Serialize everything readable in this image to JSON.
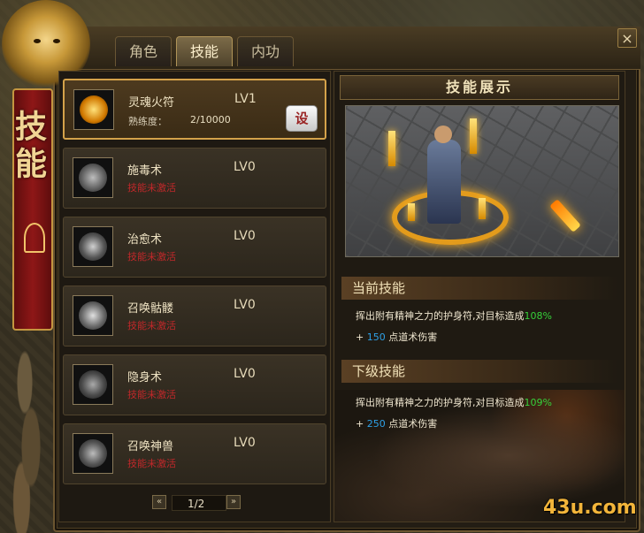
{
  "window": {
    "side_title": "技能",
    "close_label": "×"
  },
  "tabs": [
    {
      "label": "角色",
      "active": false
    },
    {
      "label": "技能",
      "active": true
    },
    {
      "label": "内功",
      "active": false
    }
  ],
  "skills": [
    {
      "name": "灵魂火符",
      "level": "LV1",
      "proficiency_label": "熟练度：",
      "proficiency_value": "2/10000",
      "set_label": "设",
      "selected": true,
      "icon": "soul-fire-talisman-icon"
    },
    {
      "name": "施毒术",
      "level": "LV0",
      "status": "技能未激活",
      "icon": "poison-icon"
    },
    {
      "name": "治愈术",
      "level": "LV0",
      "status": "技能未激活",
      "icon": "healing-icon"
    },
    {
      "name": "召唤骷髅",
      "level": "LV0",
      "status": "技能未激活",
      "icon": "skull-icon"
    },
    {
      "name": "隐身术",
      "level": "LV0",
      "status": "技能未激活",
      "icon": "invisibility-icon"
    },
    {
      "name": "召唤神兽",
      "level": "LV0",
      "status": "技能未激活",
      "icon": "divine-beast-icon"
    }
  ],
  "pager": {
    "text": "1/2",
    "prev": "«",
    "next": "»"
  },
  "display": {
    "title": "技能展示",
    "current": {
      "heading": "当前技能",
      "description": "挥出附有精神之力的护身符,对目标造成",
      "percent": "108%",
      "bonus_prefix": "+ ",
      "bonus_value": "150",
      "bonus_suffix": " 点道术伤害"
    },
    "next": {
      "heading": "下级技能",
      "description": "挥出附有精神之力的护身符,对目标造成",
      "percent": "109%",
      "bonus_prefix": "+ ",
      "bonus_value": "250",
      "bonus_suffix": " 点道术伤害"
    }
  },
  "watermark": "43u.com",
  "colors": {
    "accent_gold": "#d4a24a",
    "inactive_red": "#c0282a",
    "percent_green": "#36d13a",
    "damage_blue": "#2ea0e6"
  }
}
